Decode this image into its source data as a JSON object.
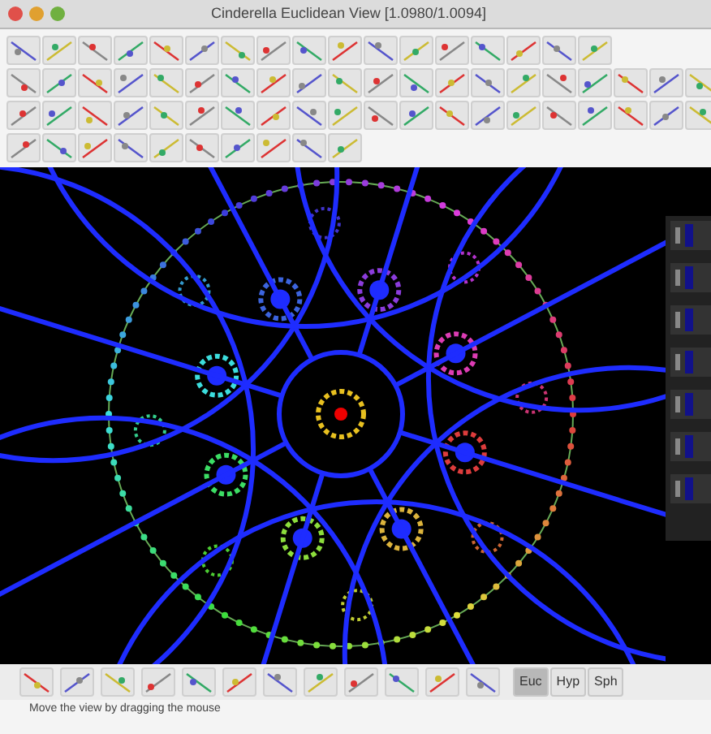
{
  "window": {
    "title": "Cinderella Euclidean View [1.0980/1.0094]"
  },
  "view_modes": [
    {
      "label": "Euc",
      "selected": true
    },
    {
      "label": "Hyp",
      "selected": false
    },
    {
      "label": "Sph",
      "selected": false
    }
  ],
  "status_bar": "Move the view by dragging the mouse"
}
